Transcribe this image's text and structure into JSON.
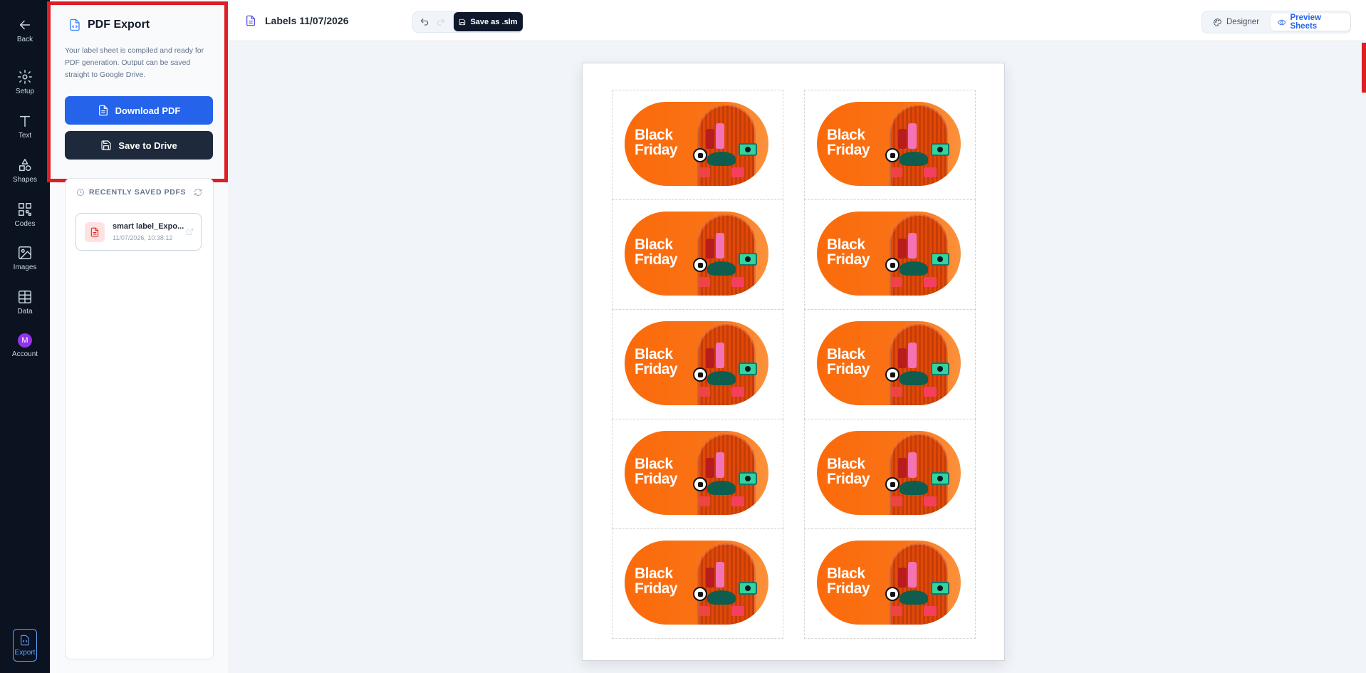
{
  "rail": {
    "back": "Back",
    "setup": "Setup",
    "text": "Text",
    "shapes": "Shapes",
    "codes": "Codes",
    "images": "Images",
    "data": "Data",
    "account": "Account",
    "account_initial": "M",
    "export": "Export"
  },
  "panel": {
    "title": "PDF Export",
    "description": "Your label sheet is compiled and ready for PDF generation. Output can be saved straight to Google Drive.",
    "download_label": "Download PDF",
    "drive_label": "Save to Drive",
    "recent_heading": "RECENTLY SAVED PDFS",
    "recent_files": [
      {
        "name": "smart label_Expo...",
        "date": "11/07/2026, 10:38:12"
      }
    ]
  },
  "toolbar": {
    "doc_title": "Labels 11/07/2026",
    "save_label": "Save as .slm",
    "designer_label": "Designer",
    "preview_label": "Preview Sheets"
  },
  "sheet": {
    "label_text_line1": "Black",
    "label_text_line2": "Friday",
    "rows": 5,
    "columns": 2
  },
  "colors": {
    "accent_blue": "#2563eb",
    "highlight_red": "#dc1f26",
    "label_orange": "#f97316"
  }
}
